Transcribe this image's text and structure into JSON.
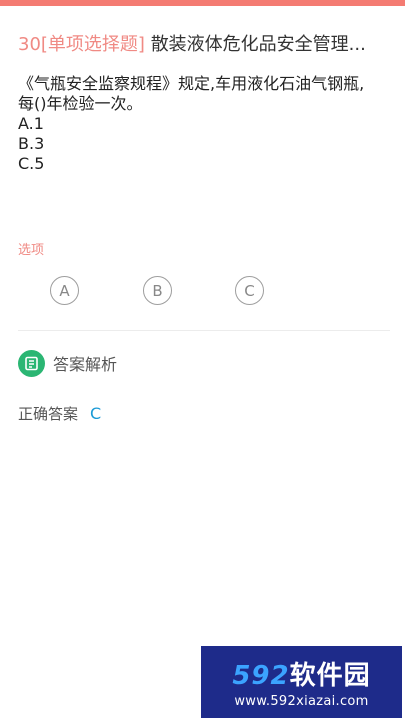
{
  "question": {
    "number": "30",
    "type": "[单项选择题]",
    "title": "散装液体危化品安全管理...",
    "line1": "《气瓶安全监察规程》规定,车用液化石油气钢瓶,",
    "line2": "每()年检验一次。",
    "options": [
      "A.1",
      "B.3",
      "C.5"
    ]
  },
  "choices": {
    "section_label": "选项",
    "buttons": [
      "A",
      "B",
      "C"
    ]
  },
  "analysis": {
    "title": "答案解析",
    "icon": "document-list-icon",
    "answer_label": "正确答案",
    "answer_value": "C"
  },
  "watermark": {
    "brand_number": "592",
    "brand_name": "软件园",
    "url": "www.592xiazai.com"
  },
  "colors": {
    "accent": "#f47b72",
    "label": "#f08a84",
    "green": "#2bb673",
    "answer": "#1a9ad6"
  }
}
